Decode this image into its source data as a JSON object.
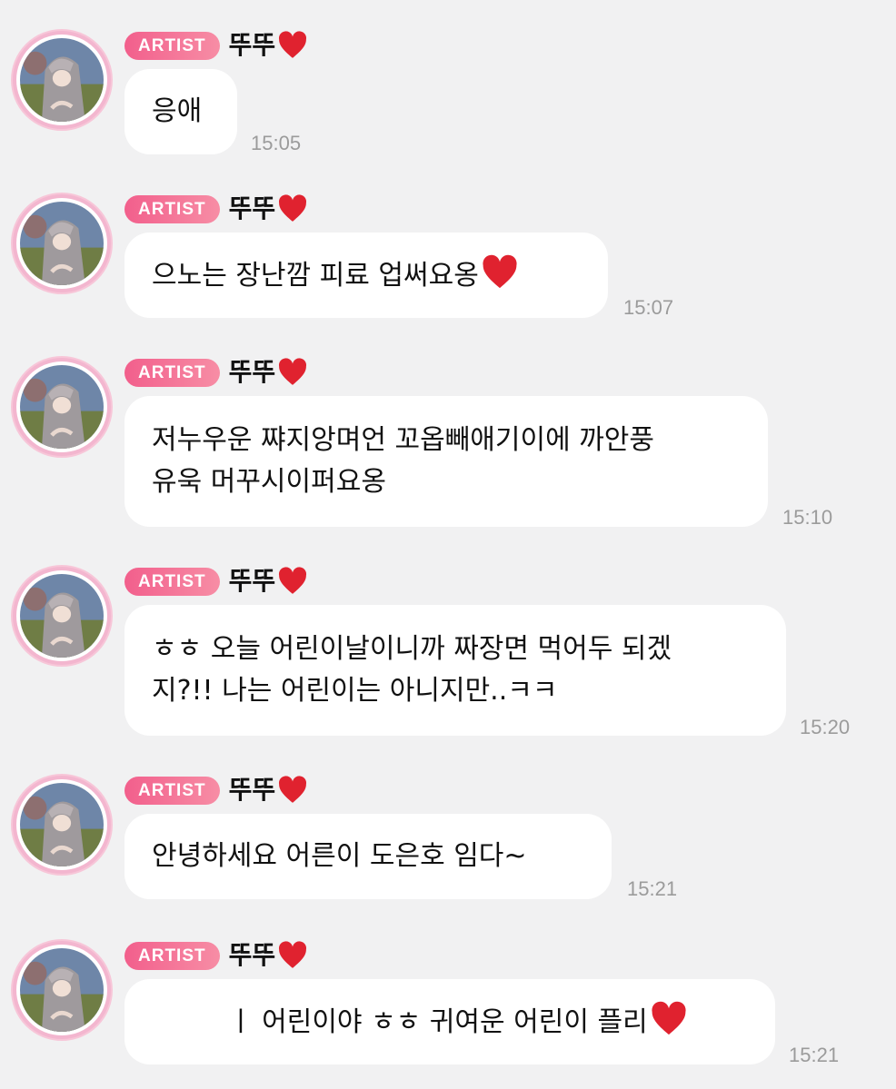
{
  "messages": [
    {
      "badge": "ARTIST",
      "name": "뚜뚜",
      "text": "응애",
      "time": "15:05",
      "heart_after_text": false
    },
    {
      "badge": "ARTIST",
      "name": "뚜뚜",
      "text": "으노는 장난깜 피료 업써요옹",
      "time": "15:07",
      "heart_after_text": true
    },
    {
      "badge": "ARTIST",
      "name": "뚜뚜",
      "text": "저누우운 쨔지앙며언 꼬옵빼애기이에 까안풍\n유욱 머꾸시이퍼요옹",
      "time": "15:10",
      "heart_after_text": false
    },
    {
      "badge": "ARTIST",
      "name": "뚜뚜",
      "text": "ㅎㅎ 오늘 어린이날이니까 짜장면 먹어두 되겠\n지?!! 나는 어린이는 아니지만..ㅋㅋ",
      "time": "15:20",
      "heart_after_text": false
    },
    {
      "badge": "ARTIST",
      "name": "뚜뚜",
      "text": "안녕하세요 어른이 도은호 임다~",
      "time": "15:21",
      "heart_after_text": false
    },
    {
      "badge": "ARTIST",
      "name": "뚜뚜",
      "text": "ㅣ 어린이야 ㅎㅎ 귀여운 어린이 플리",
      "time": "15:21",
      "heart_after_text": true
    }
  ],
  "colors": {
    "background": "#f1f1f2",
    "badge_start": "#f25f8c",
    "badge_end": "#f78da5",
    "heart": "#e0222f",
    "timestamp": "#9b9b9b"
  },
  "icons": {
    "avatar": "profile-avatar-wolf-hood",
    "heart": "red-heart-icon"
  }
}
